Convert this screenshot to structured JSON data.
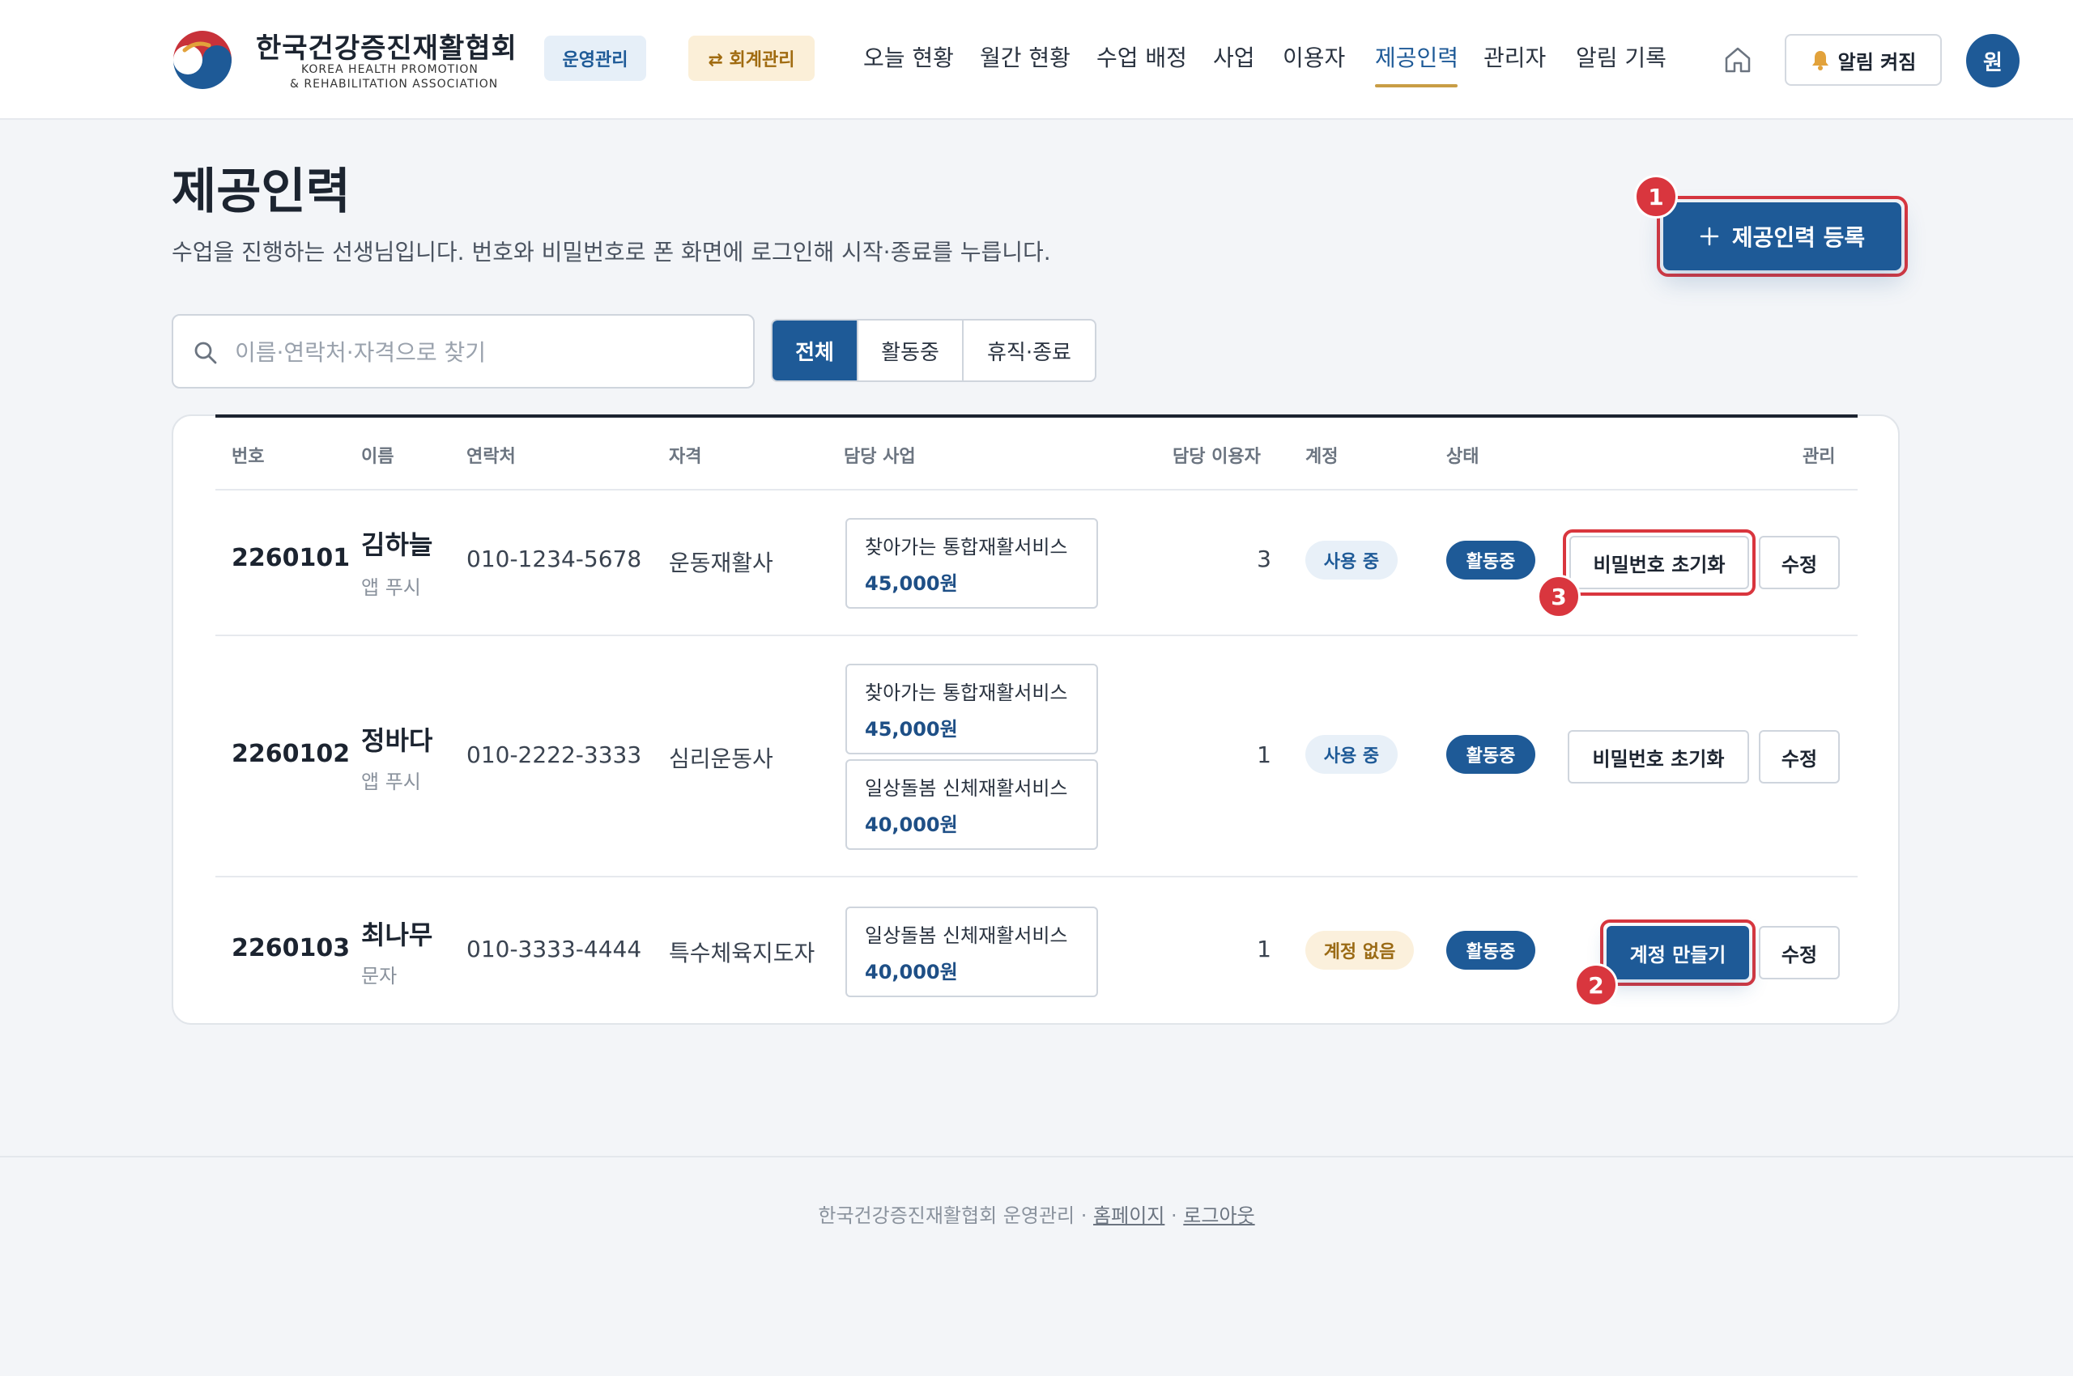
{
  "brand": {
    "name_ko": "한국건강증진재활협회",
    "name_en_1": "KOREA HEALTH PROMOTION",
    "name_en_2": "& REHABILITATION ASSOCIATION",
    "logo_icon": "taegeuk-logo-icon"
  },
  "header": {
    "ops_pill": "운영관리",
    "accounting_pill": "⇄ 회계관리",
    "nav": [
      "오늘 현황",
      "월간 현황",
      "수업 배정",
      "사업",
      "이용자",
      "제공인력",
      "관리자",
      "알림 기록"
    ],
    "active_nav": "제공인력",
    "home_icon": "home-icon",
    "alarm_label": "알림 켜짐",
    "alarm_icon": "bell-icon",
    "avatar_initial": "원"
  },
  "page": {
    "title": "제공인력",
    "description": "수업을 진행하는 선생님입니다. 번호와 비밀번호로 폰 화면에 로그인해 시작·종료를 누릅니다.",
    "add_button": "제공인력 등록",
    "add_icon": "plus-icon"
  },
  "search": {
    "placeholder": "이름·연락처·자격으로 찾기",
    "value": ""
  },
  "filters": [
    "전체",
    "활동중",
    "휴직·종료"
  ],
  "active_filter": "전체",
  "table": {
    "columns": [
      "번호",
      "이름",
      "연락처",
      "자격",
      "담당 사업",
      "담당 이용자",
      "계정",
      "상태",
      "관리"
    ],
    "rows": [
      {
        "id": "2260101",
        "name": "김하늘",
        "login_method": "앱 푸시",
        "phone": "010-1234-5678",
        "qualification": "운동재활사",
        "programs": [
          {
            "name": "찾아가는 통합재활서비스",
            "price": "45,000원"
          }
        ],
        "client_count": "3",
        "account": "사용 중",
        "status": "활동중",
        "action_primary": "비밀번호 초기화",
        "action_edit": "수정"
      },
      {
        "id": "2260102",
        "name": "정바다",
        "login_method": "앱 푸시",
        "phone": "010-2222-3333",
        "qualification": "심리운동사",
        "programs": [
          {
            "name": "찾아가는 통합재활서비스",
            "price": "45,000원"
          },
          {
            "name": "일상돌봄 신체재활서비스",
            "price": "40,000원"
          }
        ],
        "client_count": "1",
        "account": "사용 중",
        "status": "활동중",
        "action_primary": "비밀번호 초기화",
        "action_edit": "수정"
      },
      {
        "id": "2260103",
        "name": "최나무",
        "login_method": "문자",
        "phone": "010-3333-4444",
        "qualification": "특수체육지도자",
        "programs": [
          {
            "name": "일상돌봄 신체재활서비스",
            "price": "40,000원"
          }
        ],
        "client_count": "1",
        "account": "계정 없음",
        "status": "활동중",
        "action_primary": "계정 만들기",
        "action_edit": "수정"
      }
    ]
  },
  "markers": [
    "1",
    "2",
    "3"
  ],
  "footer": {
    "org": "한국건강증진재활협회 운영관리",
    "separator": "·",
    "homepage": "홈페이지",
    "logout": "로그아웃"
  },
  "colors": {
    "primary": "#1e5a97",
    "accent_gold": "#c89d45",
    "highlight_red": "#d9363e",
    "background": "#f3f5f8"
  }
}
